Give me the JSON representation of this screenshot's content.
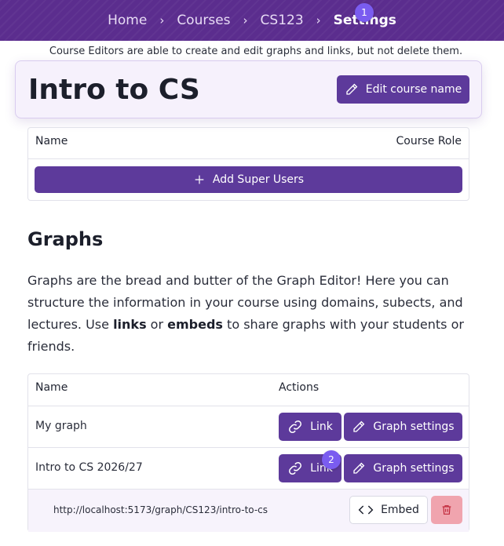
{
  "breadcrumb": {
    "items": [
      "Home",
      "Courses",
      "CS123",
      "Settings"
    ],
    "separator": "›",
    "badge": "1"
  },
  "note": "Course Editors are able to create and edit graphs and links, but not delete them.",
  "course": {
    "title": "Intro to CS",
    "edit_label": "Edit course name"
  },
  "super_users": {
    "col_name": "Name",
    "col_role": "Course Role",
    "add_label": "Add Super Users"
  },
  "graphs": {
    "heading": "Graphs",
    "desc_1": "Graphs are the bread and butter of the Graph Editor! Here you can structure the information in your course using domains, subects, and lectures. Use ",
    "desc_links": "links",
    "desc_or": " or ",
    "desc_embeds": "embeds",
    "desc_2": " to share graphs with your students or friends.",
    "col_name": "Name",
    "col_actions": "Actions",
    "rows": [
      {
        "name": "My graph",
        "link_label": "Link",
        "settings_label": "Graph settings"
      },
      {
        "name": "Intro to CS 2026/27",
        "link_label": "Link",
        "settings_label": "Graph settings"
      }
    ],
    "link_url": "http://localhost:5173/graph/CS123/intro-to-cs",
    "embed_label": "Embed",
    "badge": "2"
  },
  "colors": {
    "accent": "#5d3a9b",
    "topbar": "#5b2d8e",
    "badge": "#7a5cf0",
    "danger_bg": "#f0a4ae"
  }
}
